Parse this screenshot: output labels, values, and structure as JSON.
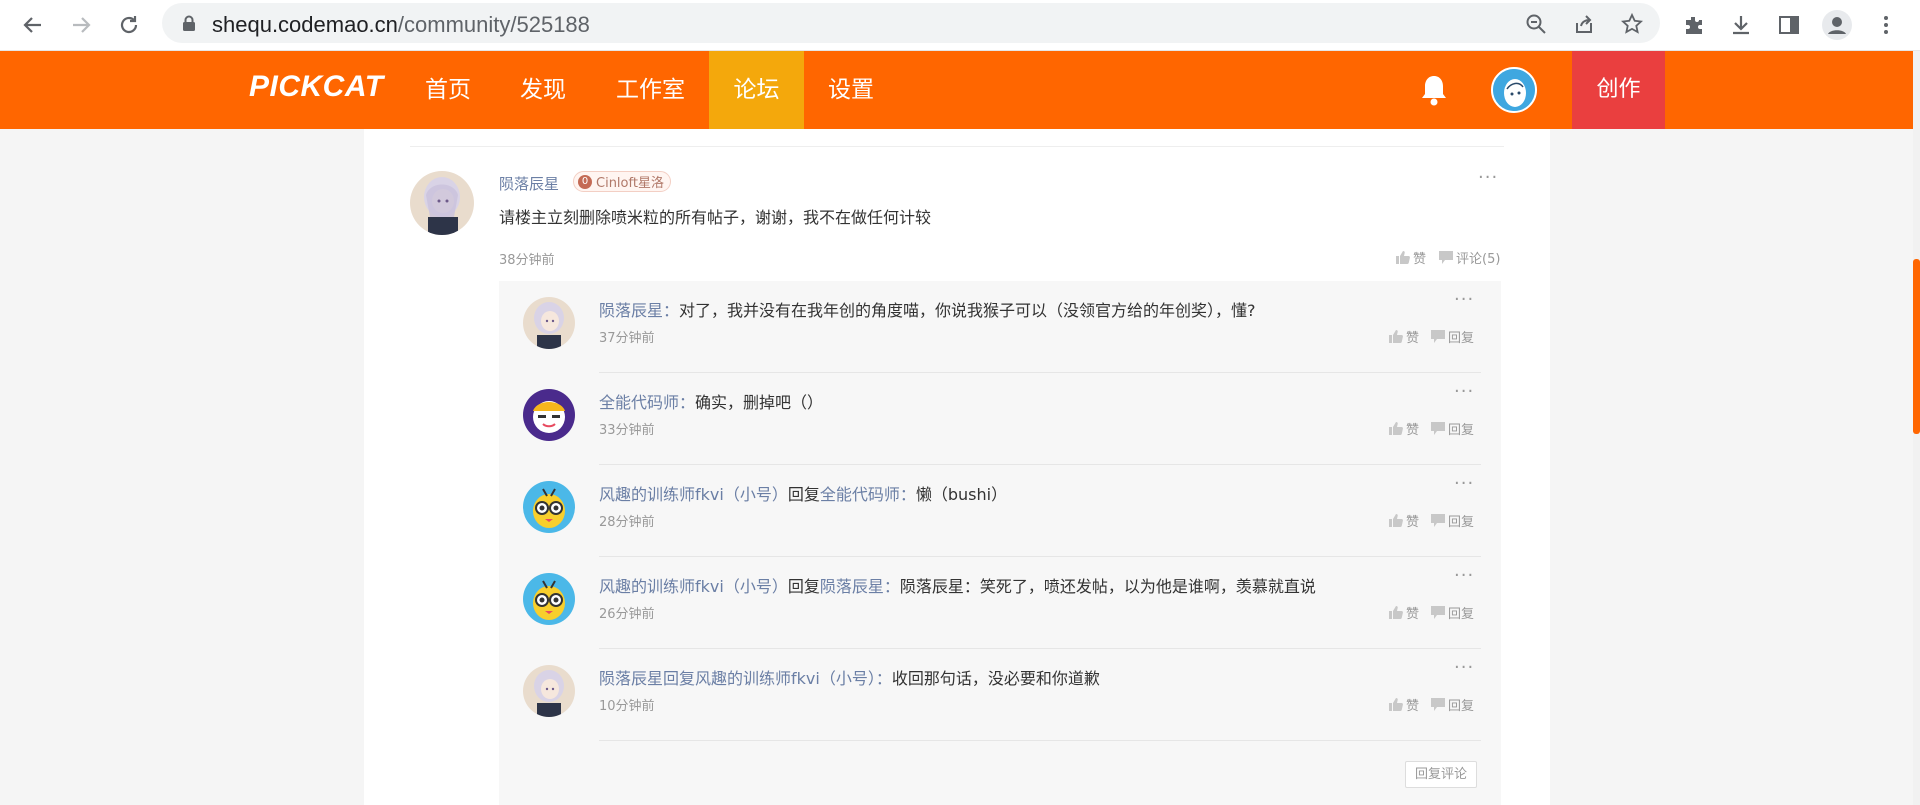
{
  "browser": {
    "url_host": "shequ.codemao.cn",
    "url_path": "/community/525188"
  },
  "header": {
    "logo": "PICKCAT",
    "nav": [
      {
        "label": "首页",
        "active": false
      },
      {
        "label": "发现",
        "active": false
      },
      {
        "label": "工作室",
        "active": false
      },
      {
        "label": "论坛",
        "active": true
      },
      {
        "label": "设置",
        "active": false
      }
    ],
    "create_label": "创作"
  },
  "colors": {
    "brand": "#ff6600",
    "active_tab": "#f4a80c",
    "create": "#ea3f3f",
    "link": "#6b7fa5"
  },
  "comment": {
    "user": "陨落辰星",
    "badge_level": "0",
    "badge_text": "Cinloft星洛",
    "text": "请楼主立刻删除喷米粒的所有帖子，谢谢，我不在做任何计较",
    "time": "38分钟前",
    "like_label": "赞",
    "comment_label": "评论(5)",
    "more": "···"
  },
  "replies": [
    {
      "user": "陨落辰星",
      "reply_word": "",
      "target": "",
      "sep": "：",
      "text": "对了，我并没有在我年创的角度喵，你说我猴子可以（没领官方给的年创奖），懂?",
      "time": "37分钟前",
      "avatar": "anime-girl-avatar"
    },
    {
      "user": "全能代码师",
      "reply_word": "",
      "target": "",
      "sep": "：",
      "text": "确实，删掉吧（）",
      "time": "33分钟前",
      "avatar": "purple-robot-avatar"
    },
    {
      "user": "风趣的训练师fkvi（小号）",
      "reply_word": "回复",
      "target": "全能代码师",
      "sep": "：",
      "text": "懒（bushi）",
      "time": "28分钟前",
      "avatar": "yellow-bee-avatar"
    },
    {
      "user": "风趣的训练师fkvi（小号）",
      "reply_word": "回复",
      "target": "陨落辰星",
      "sep": "：",
      "text": "陨落辰星：笑死了，喷还发帖，以为他是谁啊，羡慕就直说",
      "time": "26分钟前",
      "avatar": "yellow-bee-avatar"
    },
    {
      "user": "陨落辰星",
      "reply_word": "回复",
      "target": "风趣的训练师fkvi（小号）",
      "sep": "：",
      "text": "收回那句话，没必要和你道歉",
      "time": "10分钟前",
      "avatar": "anime-girl-avatar"
    }
  ],
  "reply_actions": {
    "like": "赞",
    "reply": "回复",
    "more": "···"
  },
  "reply_comment_button": "回复评论"
}
